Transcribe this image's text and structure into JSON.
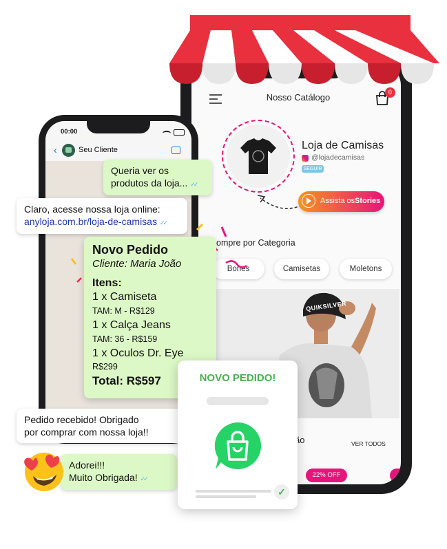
{
  "catalog": {
    "header_title": "Nosso Catálogo",
    "cart_count": "0",
    "store_name": "Loja de Camisas",
    "store_handle": "@lojadecamisas",
    "follow_label": "SEGUIR",
    "stories_prefix": "Assista os",
    "stories_bold": "Stories",
    "category_title": "ompre por Categoria",
    "categories": [
      "Bones",
      "Camisetas",
      "Moletons"
    ],
    "section_partial": "ão",
    "see_all": "VER TODOS",
    "discount_badge": "22% OFF",
    "shirt_brand": "QUIKSILVER"
  },
  "chat": {
    "status_time": "00:00",
    "contact_name": "Seu Cliente",
    "msg_customer_1": "Queria ver os produtos da loja...",
    "msg_store_1_line1": "Claro, acesse nossa loja online:",
    "msg_store_1_link": "anyloja.com.br/loja-de-camisas",
    "order": {
      "title": "Novo Pedido",
      "client": "Cliente: Maria João",
      "items_label": "Itens:",
      "item1": "1 x Camiseta",
      "item1_detail": "TAM: M - R$129",
      "item2": "1 x Calça Jeans",
      "item2_detail": "TAM: 36 - R$159",
      "item3": "1 x Oculos Dr. Eye",
      "item3_detail": "R$299",
      "total": "Total: R$597"
    },
    "msg_store_2_line1": "Pedido recebido! Obrigado",
    "msg_store_2_line2": "por comprar com nossa loja!!",
    "msg_customer_2_line1": "Adorei!!!",
    "msg_customer_2_line2": "Muito Obrigada!"
  },
  "notification": {
    "title": "NOVO PEDIDO!"
  },
  "colors": {
    "awning_red": "#e8303f",
    "whatsapp_green": "#25d366",
    "chat_green": "#dcf8c6",
    "notification_green": "#4caf50",
    "stories_gradient_start": "#f7941d",
    "stories_gradient_end": "#e6157b"
  }
}
